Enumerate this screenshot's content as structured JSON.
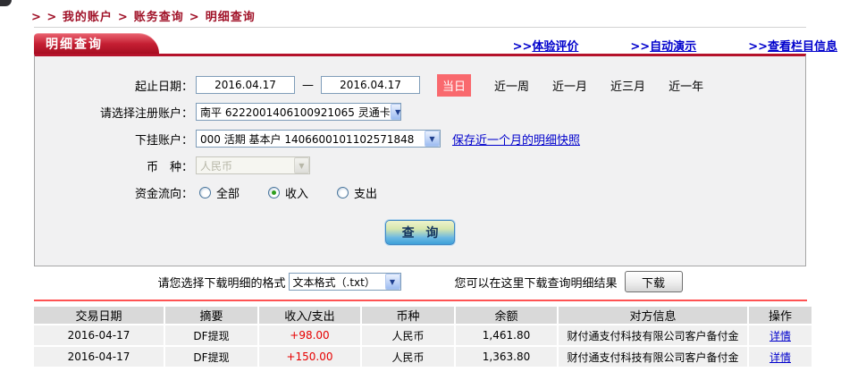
{
  "colors": {
    "accent_red": "#b5122b",
    "badge_red": "#f9696e",
    "link_blue": "#0000cc",
    "amount_red": "#e60000",
    "table_header_grey": "#d9d9d9",
    "table_row_grey": "#f0f0f0",
    "query_btn_top": "#edf3cb",
    "query_btn_bottom": "#3da0d9"
  },
  "page": {
    "breadcrumb": {
      "prefix": "> >",
      "separator": ">",
      "items": [
        "我的账户",
        "账务查询",
        "明细查询"
      ]
    },
    "tab_label": "明细查询",
    "top_links": [
      {
        "prefix": ">>",
        "label": "体验评价"
      },
      {
        "prefix": ">>",
        "label": "自动演示"
      },
      {
        "prefix": ">>",
        "label": "查看栏目信息"
      }
    ]
  },
  "form": {
    "date_range": {
      "label": "起止日期：",
      "start": "2016.04.17",
      "dash": "—",
      "end": "2016.04.17",
      "quick_active": "当日",
      "quick_links": [
        "近一周",
        "近一月",
        "近三月",
        "近一年"
      ]
    },
    "register_account": {
      "label": "请选择注册账户：",
      "value": "南平 6222001406100921065 灵通卡"
    },
    "sub_account": {
      "label": "下挂账户：",
      "value": "000 活期 基本户 1406600101102571848",
      "snapshot_link": "保存近一个月的明细快照"
    },
    "currency": {
      "label": "币　种：",
      "value": "人民币"
    },
    "flow": {
      "label": "资金流向：",
      "options": [
        {
          "label": "全部",
          "checked": false
        },
        {
          "label": "收入",
          "checked": true
        },
        {
          "label": "支出",
          "checked": false
        }
      ]
    },
    "query_button": "查 询"
  },
  "download": {
    "format_label": "请您选择下载明细的格式",
    "format_value": "文本格式（.txt）",
    "hint": "您可以在这里下载查询明细结果",
    "button": "下载"
  },
  "table": {
    "headers": [
      "交易日期",
      "摘要",
      "收入/支出",
      "币种",
      "余额",
      "对方信息",
      "操作"
    ],
    "rows": [
      {
        "date": "2016-04-17",
        "summary": "DF提现",
        "amount": "+98.00",
        "currency": "人民币",
        "balance": "1,461.80",
        "counterparty": "财付通支付科技有限公司客户备付金",
        "action": "详情"
      },
      {
        "date": "2016-04-17",
        "summary": "DF提现",
        "amount": "+150.00",
        "currency": "人民币",
        "balance": "1,363.80",
        "counterparty": "财付通支付科技有限公司客户备付金",
        "action": "详情"
      }
    ]
  }
}
